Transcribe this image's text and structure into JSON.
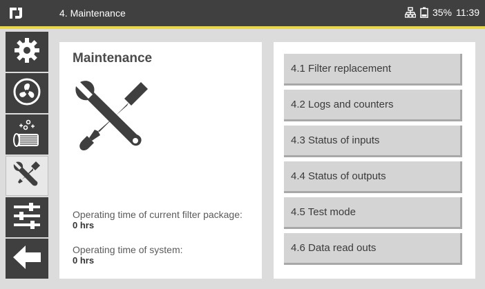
{
  "header": {
    "title": "4. Maintenance",
    "battery": "35%",
    "time": "11:39"
  },
  "colors": {
    "topbar": "#404040",
    "accent": "#e8d84a",
    "sidebar_icon_bg": "#3f3f3f",
    "menu_button": "#d4d4d4"
  },
  "sidebar": {
    "items": [
      {
        "icon": "gear-icon"
      },
      {
        "icon": "fan-icon"
      },
      {
        "icon": "filter-cleaning-icon"
      },
      {
        "icon": "maintenance-tools-icon",
        "active": true
      },
      {
        "icon": "sliders-icon"
      },
      {
        "icon": "back-arrow-icon"
      }
    ]
  },
  "main": {
    "heading": "Maintenance",
    "filter_time_label": "Operating time of current filter package:",
    "filter_time_value": "0 hrs",
    "system_time_label": "Operating time of system:",
    "system_time_value": "0 hrs"
  },
  "menu": {
    "items": [
      {
        "label": "4.1 Filter replacement"
      },
      {
        "label": "4.2 Logs and counters"
      },
      {
        "label": "4.3 Status of inputs"
      },
      {
        "label": "4.4 Status of outputs"
      },
      {
        "label": "4.5 Test mode"
      },
      {
        "label": "4.6 Data read outs"
      }
    ]
  }
}
